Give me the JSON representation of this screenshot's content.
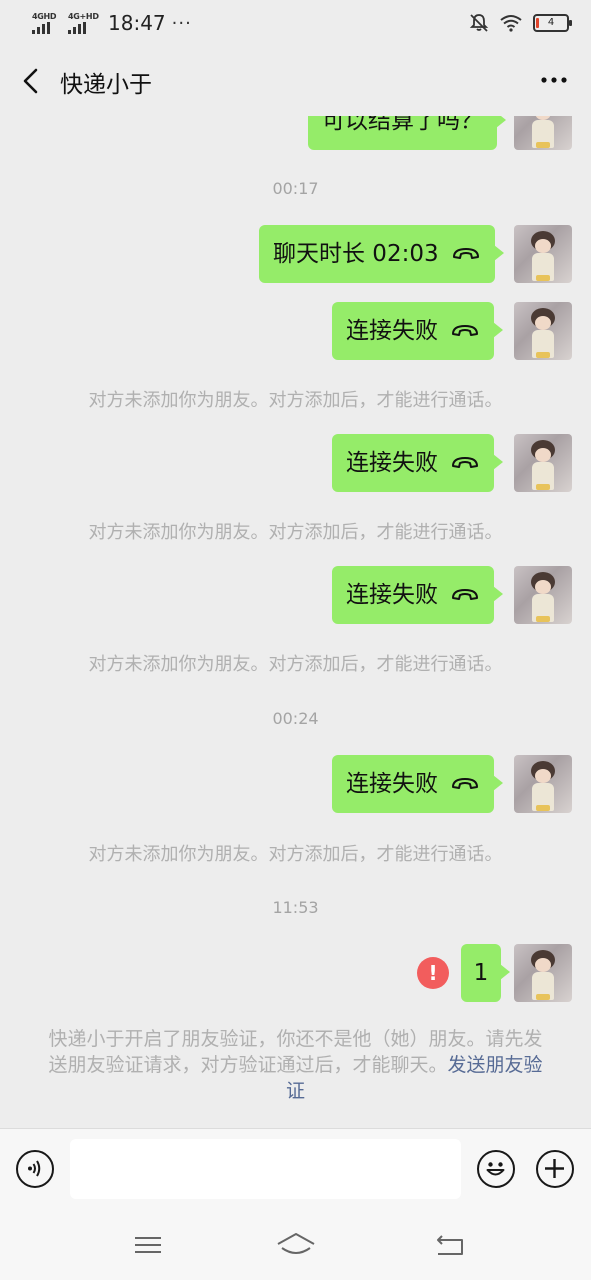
{
  "status_bar": {
    "sim1_label": "4GHD",
    "sim2_label": "4G+HD",
    "time": "18:47",
    "overflow_dots": "···",
    "battery_level": "4"
  },
  "header": {
    "title": "快递小于"
  },
  "chat": {
    "partial_message": "可以结算了吗？",
    "timestamps": [
      "00:17",
      "00:24",
      "11:53"
    ],
    "call_messages": [
      "聊天时长 02:03",
      "连接失败",
      "连接失败",
      "连接失败",
      "连接失败"
    ],
    "system_note": "对方未添加你为朋友。对方添加后，才能进行通话。",
    "last_message": "1",
    "error_mark": "!",
    "friend_verify_notice": "快递小于开启了朋友验证，你还不是他（她）朋友。请先发送朋友验证请求，对方验证通过后，才能聊天。",
    "friend_verify_link": "发送朋友验证"
  },
  "input_bar": {
    "placeholder": ""
  },
  "colors": {
    "bubble_green": "#95ec69",
    "background": "#ededed",
    "link_blue": "#576b95",
    "error_red": "#f25d5d"
  }
}
